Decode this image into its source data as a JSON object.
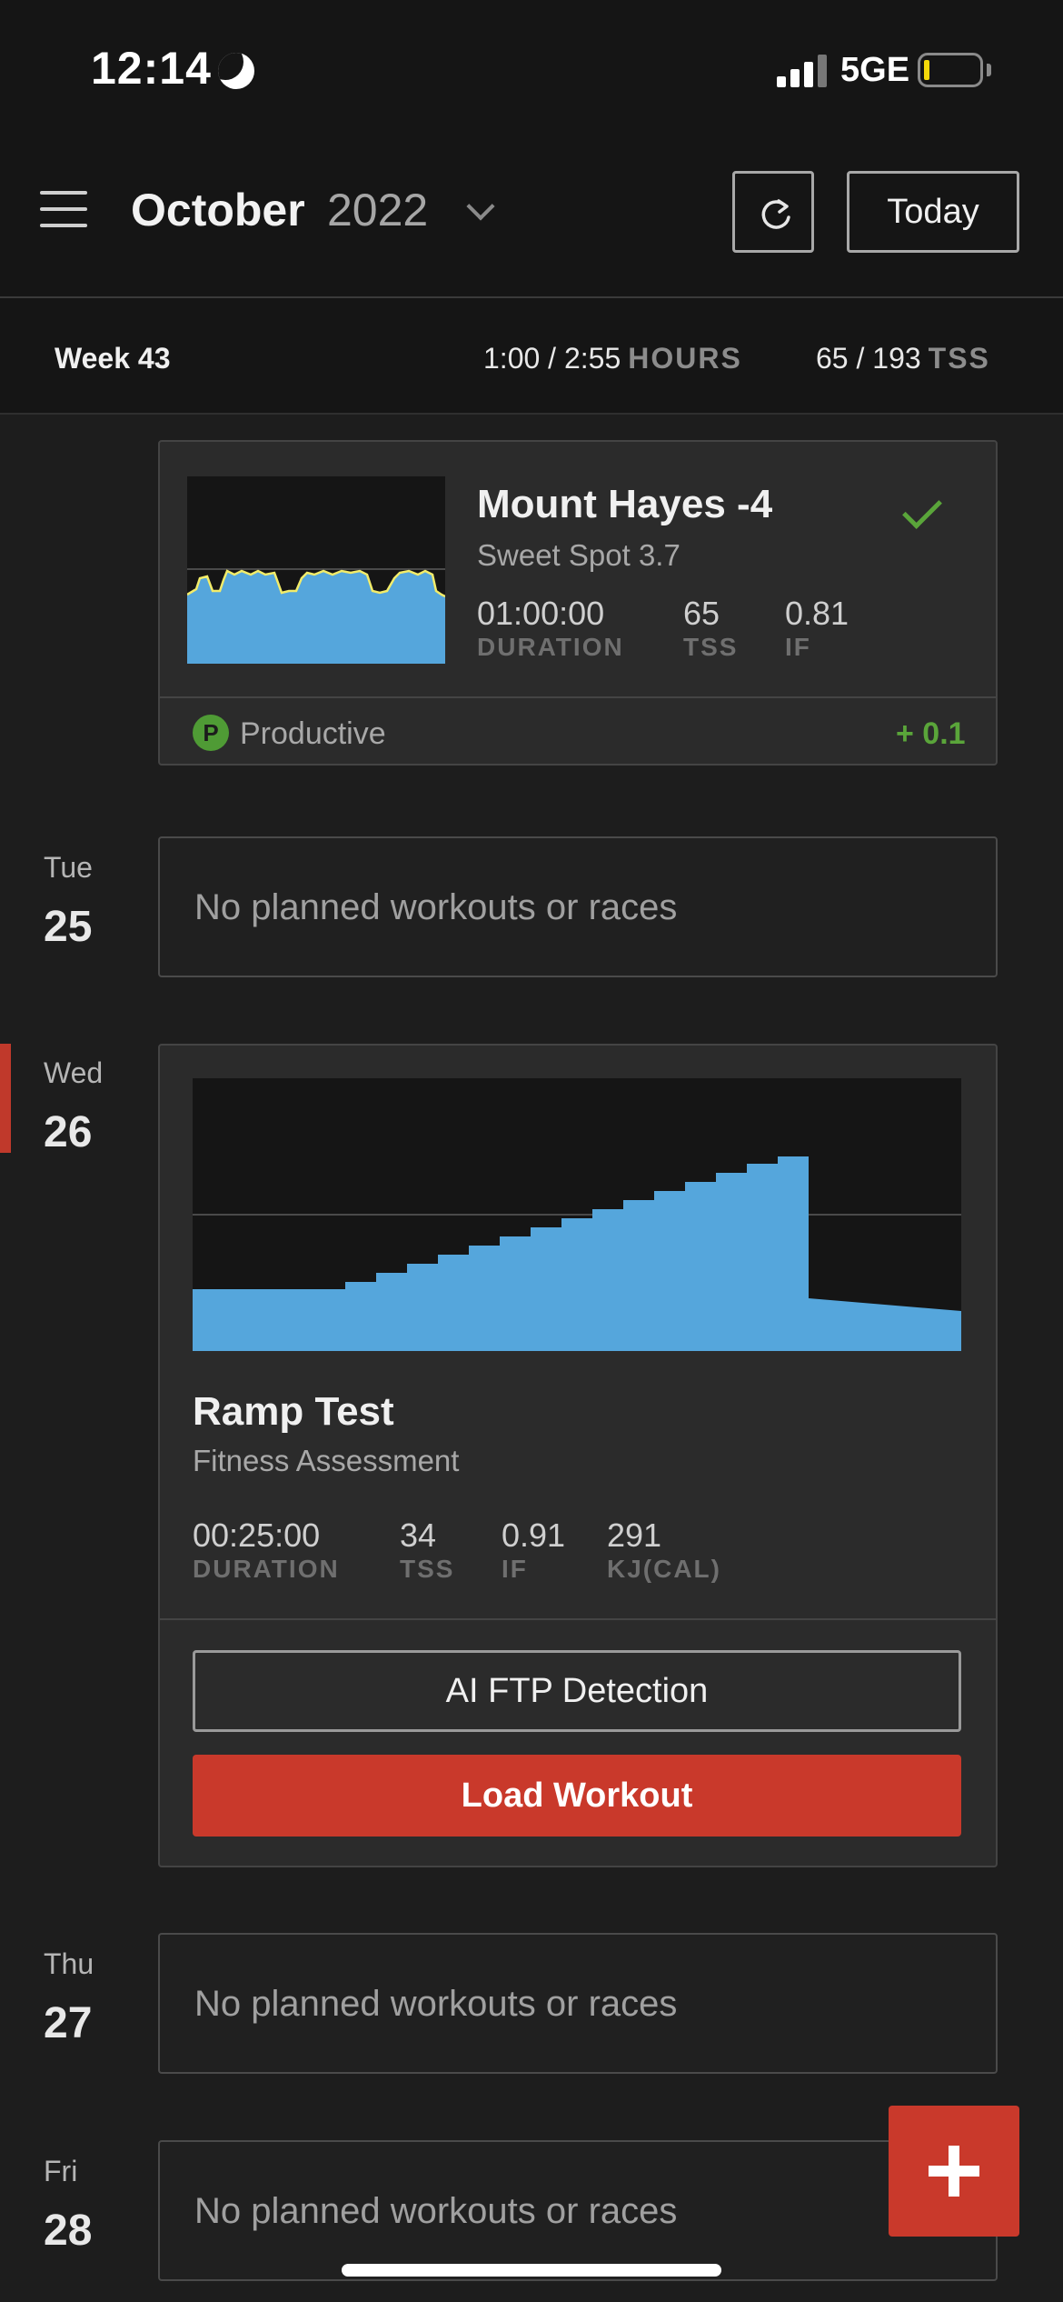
{
  "status_bar": {
    "time": "12:14",
    "network": "5GE",
    "icons": [
      "moon-icon",
      "signal-icon",
      "battery-icon"
    ]
  },
  "header": {
    "month": "October",
    "year": "2022",
    "today_label": "Today",
    "icons": [
      "menu-icon",
      "chevron-down-icon",
      "refresh-icon"
    ]
  },
  "week": {
    "label": "Week 43",
    "hours_value": "1:00 / 2:55",
    "hours_unit": "HOURS",
    "tss_value": "65 / 193",
    "tss_unit": "TSS"
  },
  "completed_workout": {
    "title": "Mount Hayes -4",
    "subtitle": "Sweet Spot 3.7",
    "stats": [
      {
        "value": "01:00:00",
        "label": "DURATION"
      },
      {
        "value": "65",
        "label": "TSS"
      },
      {
        "value": "0.81",
        "label": "IF"
      }
    ],
    "status_badge": "P",
    "status_label": "Productive",
    "delta": "+ 0.1",
    "completed": true
  },
  "days": [
    {
      "name": "Tue",
      "number": "25",
      "empty_text": "No planned workouts or races"
    },
    {
      "name": "Wed",
      "number": "26"
    },
    {
      "name": "Thu",
      "number": "27",
      "empty_text": "No planned workouts or races"
    },
    {
      "name": "Fri",
      "number": "28",
      "empty_text": "No planned workouts or races"
    }
  ],
  "planned_workout": {
    "title": "Ramp Test",
    "subtitle": "Fitness Assessment",
    "stats": [
      {
        "value": "00:25:00",
        "label": "DURATION"
      },
      {
        "value": "34",
        "label": "TSS"
      },
      {
        "value": "0.91",
        "label": "IF"
      },
      {
        "value": "291",
        "label": "KJ(CAL)"
      }
    ],
    "ai_ftp_label": "AI FTP Detection",
    "load_label": "Load Workout"
  },
  "colors": {
    "accent_red": "#c9392b",
    "productive_green": "#5aa53a",
    "chart_blue": "#55a6dc",
    "chart_yellow": "#f2ec6a"
  }
}
